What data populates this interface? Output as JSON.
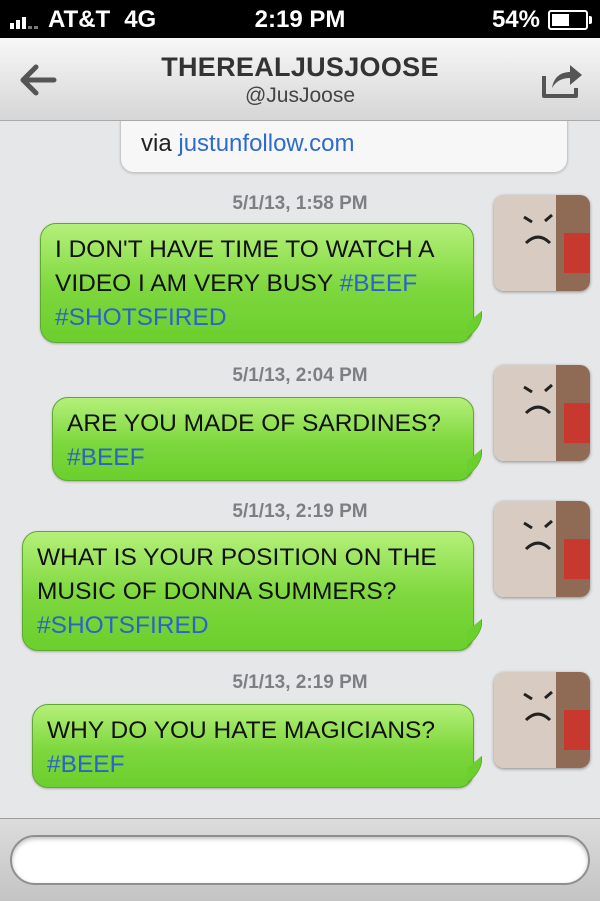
{
  "status_bar": {
    "carrier": "AT&T",
    "network": "4G",
    "time": "2:19 PM",
    "battery_text": "54%",
    "battery_level": 0.54
  },
  "nav": {
    "title": "THEREALJUSJOOSE",
    "handle": "@JusJoose",
    "back_icon": "back-arrow-icon",
    "share_icon": "share-icon"
  },
  "previous_message": {
    "via_label": "via",
    "via_link": "justunfollow.com"
  },
  "messages": [
    {
      "timestamp": "5/1/13, 1:58 PM",
      "lines": [
        "I DON'T HAVE TIME TO WATCH A",
        "VIDEO I AM VERY BUSY "
      ],
      "tags": [
        "#BEEF",
        "#SHOTSFIRED"
      ]
    },
    {
      "timestamp": "5/1/13, 2:04 PM",
      "lines": [
        "ARE YOU MADE OF SARDINES?"
      ],
      "tags": [
        "#BEEF"
      ]
    },
    {
      "timestamp": "5/1/13, 2:19 PM",
      "lines": [
        "WHAT IS YOUR POSITION ON THE",
        "MUSIC OF DONNA SUMMERS?"
      ],
      "tags": [
        "#SHOTSFIRED"
      ]
    },
    {
      "timestamp": "5/1/13, 2:19 PM",
      "lines": [
        "WHY DO YOU HATE MAGICIANS?"
      ],
      "tags": [
        "#BEEF"
      ]
    }
  ],
  "colors": {
    "bubble_green": "#7dd73d",
    "hashtag_blue": "#2a63c9",
    "timestamp_gray": "#7d7f83"
  }
}
